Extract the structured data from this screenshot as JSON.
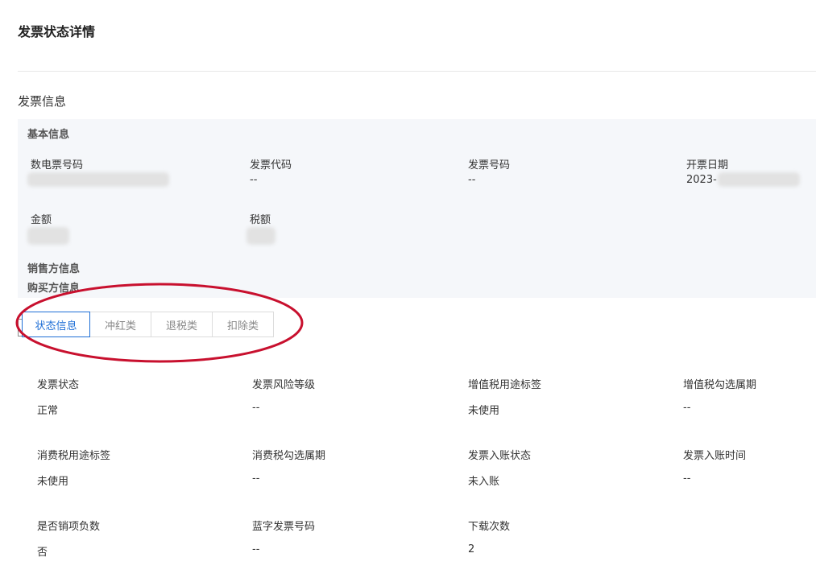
{
  "page": {
    "title": "发票状态详情"
  },
  "invoice_section": {
    "title": "发票信息"
  },
  "basic_info": {
    "title": "基本信息",
    "fields": [
      {
        "label": "数电票号码",
        "value": ""
      },
      {
        "label": "发票代码",
        "value": "--"
      },
      {
        "label": "发票号码",
        "value": "--"
      },
      {
        "label": "开票日期",
        "value": "2023-"
      },
      {
        "label": "金额",
        "value": ""
      },
      {
        "label": "税额",
        "value": ""
      }
    ]
  },
  "seller_info": {
    "title": "销售方信息"
  },
  "buyer_info": {
    "title": "购买方信息"
  },
  "tabs": [
    {
      "label": "状态信息",
      "active": true
    },
    {
      "label": "冲红类",
      "active": false
    },
    {
      "label": "退税类",
      "active": false
    },
    {
      "label": "扣除类",
      "active": false
    }
  ],
  "status_fields": [
    {
      "label": "发票状态",
      "value": "正常"
    },
    {
      "label": "发票风险等级",
      "value": "--"
    },
    {
      "label": "增值税用途标签",
      "value": "未使用"
    },
    {
      "label": "增值税勾选属期",
      "value": "--"
    },
    {
      "label": "消费税用途标签",
      "value": "未使用"
    },
    {
      "label": "消费税勾选属期",
      "value": "--"
    },
    {
      "label": "发票入账状态",
      "value": "未入账"
    },
    {
      "label": "发票入账时间",
      "value": "--"
    },
    {
      "label": "是否销项负数",
      "value": "否"
    },
    {
      "label": "蓝字发票号码",
      "value": "--"
    },
    {
      "label": "下载次数",
      "value": "2"
    }
  ],
  "colors": {
    "accent": "#1f6fd6",
    "annotation": "#c8102e",
    "panel_bg": "#f5f7fa"
  }
}
